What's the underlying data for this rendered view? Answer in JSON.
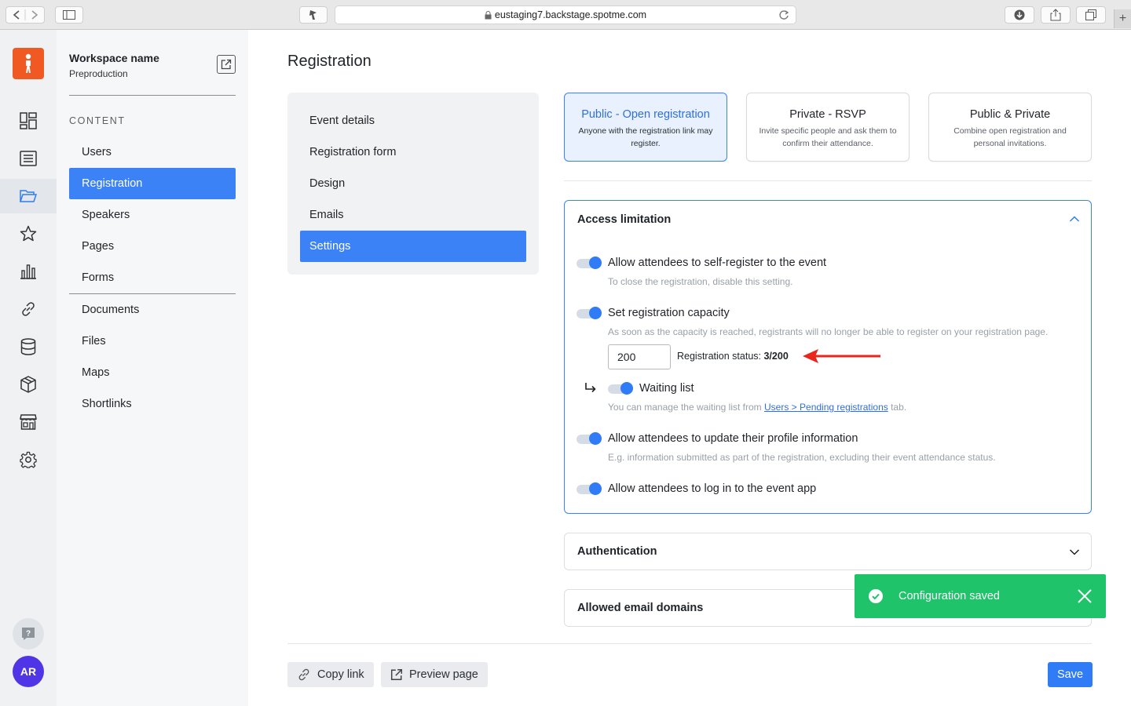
{
  "browser": {
    "url": "eustaging7.backstage.spotme.com"
  },
  "workspace": {
    "name": "Workspace name",
    "subtitle": "Preproduction"
  },
  "sidebar": {
    "section_label": "CONTENT",
    "items": [
      {
        "label": "Users"
      },
      {
        "label": "Registration"
      },
      {
        "label": "Speakers"
      },
      {
        "label": "Pages"
      },
      {
        "label": "Forms"
      },
      {
        "label": "Documents"
      },
      {
        "label": "Files"
      },
      {
        "label": "Maps"
      },
      {
        "label": "Shortlinks"
      }
    ],
    "active": "Registration"
  },
  "rail": {
    "avatar_initials": "AR",
    "icons": [
      "dashboard-icon",
      "list-icon",
      "folder-icon",
      "star-icon",
      "bar-chart-icon",
      "link-icon",
      "database-icon",
      "box-icon",
      "store-icon",
      "gear-icon"
    ]
  },
  "page": {
    "title": "Registration"
  },
  "subnav": {
    "items": [
      {
        "label": "Event details"
      },
      {
        "label": "Registration form"
      },
      {
        "label": "Design"
      },
      {
        "label": "Emails"
      },
      {
        "label": "Settings"
      }
    ],
    "active": "Settings"
  },
  "registration_types": [
    {
      "title": "Public - Open registration",
      "description": "Anyone with the registration link may register.",
      "selected": true
    },
    {
      "title": "Private - RSVP",
      "description": "Invite specific people and ask them to confirm their attendance.",
      "selected": false
    },
    {
      "title": "Public & Private",
      "description": "Combine open registration and personal invitations.",
      "selected": false
    }
  ],
  "access_limitation": {
    "title": "Access limitation",
    "options": {
      "self_register": {
        "label": "Allow attendees to self-register to the event",
        "help": "To close the registration, disable this setting.",
        "enabled": true
      },
      "capacity": {
        "label": "Set registration capacity",
        "help": "As soon as the capacity is reached, registrants will no longer be able to register on your registration page.",
        "enabled": true,
        "value": "200",
        "status_label": "Registration status:",
        "status_value": "3/200"
      },
      "waiting_list": {
        "label": "Waiting list",
        "help_prefix": "You can manage the waiting list from ",
        "help_link": "Users > Pending registrations",
        "help_suffix": " tab.",
        "enabled": true
      },
      "update_profile": {
        "label": "Allow attendees to update their profile information",
        "help": "E.g. information submitted as part of the registration, excluding their event attendance status.",
        "enabled": true
      },
      "login": {
        "label": "Allow attendees to log in to the event app",
        "enabled": true
      }
    }
  },
  "authentication": {
    "title": "Authentication"
  },
  "allowed_domains": {
    "title": "Allowed email domains"
  },
  "footer": {
    "copy_link": "Copy link",
    "preview_page": "Preview page",
    "save": "Save"
  },
  "toast": {
    "message": "Configuration saved",
    "color": "#1fc36a"
  },
  "colors": {
    "accent": "#3b82f6",
    "brand": "#f05a22",
    "annotation_arrow": "#e8261c"
  }
}
